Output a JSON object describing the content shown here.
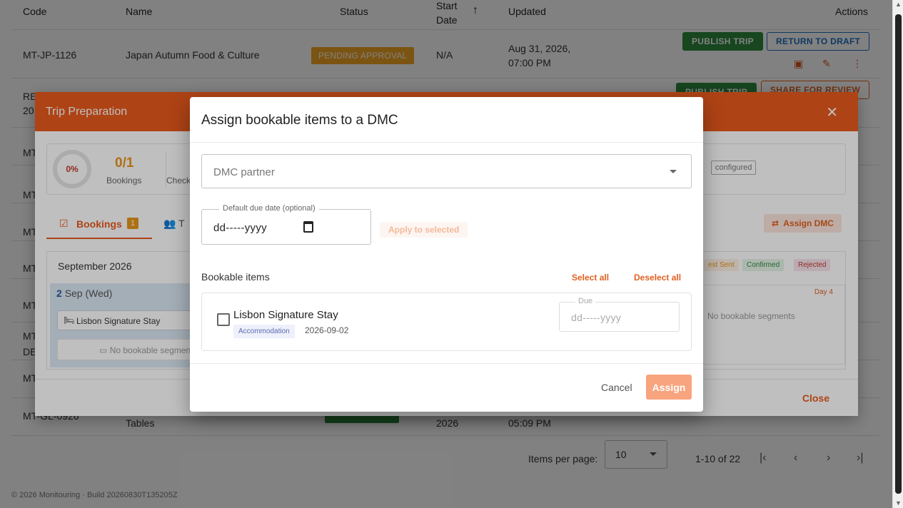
{
  "table": {
    "headers": {
      "code": "Code",
      "name": "Name",
      "status": "Status",
      "start_date": "Start\nDate",
      "updated": "Updated",
      "actions": "Actions"
    },
    "row1": {
      "code": "MT-JP-1126",
      "name": "Japan Autumn Food & Culture",
      "status": "PENDING APPROVAL",
      "start": "N/A",
      "updated": "Aug 31, 2026,\n07:00 PM",
      "publish": "PUBLISH TRIP",
      "return": "RETURN TO DRAFT"
    },
    "row2": {
      "code": "RE\n20",
      "publish": "PUBLISH TRIP",
      "share": "SHARE FOR REVIEW"
    },
    "partial_codes": [
      "MT",
      "MT",
      "MT",
      "MT",
      "MT",
      "MT\nDE",
      "MT"
    ],
    "last_row": {
      "code": "MT-GL-0926",
      "name": "Tables",
      "start": "2026",
      "updated": "05:09 PM"
    }
  },
  "pager": {
    "label": "Items per page:",
    "size": "10",
    "range": "1-10 of 22"
  },
  "footer": {
    "text": "© 2026 Monitouring · Build 20260830T135205Z"
  },
  "trip_dialog": {
    "title": "Trip Preparation",
    "progress": "0%",
    "bookings_count": "0/1",
    "bookings_label": "Bookings",
    "check_label": "Check",
    "configured": "configured",
    "tab_bookings": "Bookings",
    "tab_bookings_count": "1",
    "tab_team": "T",
    "assign_dmc": "Assign DMC",
    "month": "September 2026",
    "legend": [
      "est Sent",
      "Confirmed",
      "Rejected"
    ],
    "day1_num": "2",
    "day1_rest": "Sep (Wed)",
    "segment": "Lisbon Signature Stay",
    "no_segments": "No bookable segmen",
    "day4": "Day 4",
    "day4_text": "No bookable segments",
    "close": "Close"
  },
  "modal": {
    "title": "Assign bookable items to a DMC",
    "dmc_placeholder": "DMC partner",
    "due_label": "Default due date (optional)",
    "due_value": "dd-----yyyy",
    "apply": "Apply to selected",
    "bookable_label": "Bookable items",
    "select_all": "Select all",
    "deselect_all": "Deselect all",
    "item": {
      "name": "Lisbon Signature Stay",
      "tag": "Accommodation",
      "date": "2026-09-02",
      "due_label": "Due",
      "due_value": "dd-----yyyy"
    },
    "cancel": "Cancel",
    "assign": "Assign"
  },
  "colors": {
    "brand": "#e85a1c",
    "pending": "#f5a623",
    "publish": "#2e8b3e"
  }
}
